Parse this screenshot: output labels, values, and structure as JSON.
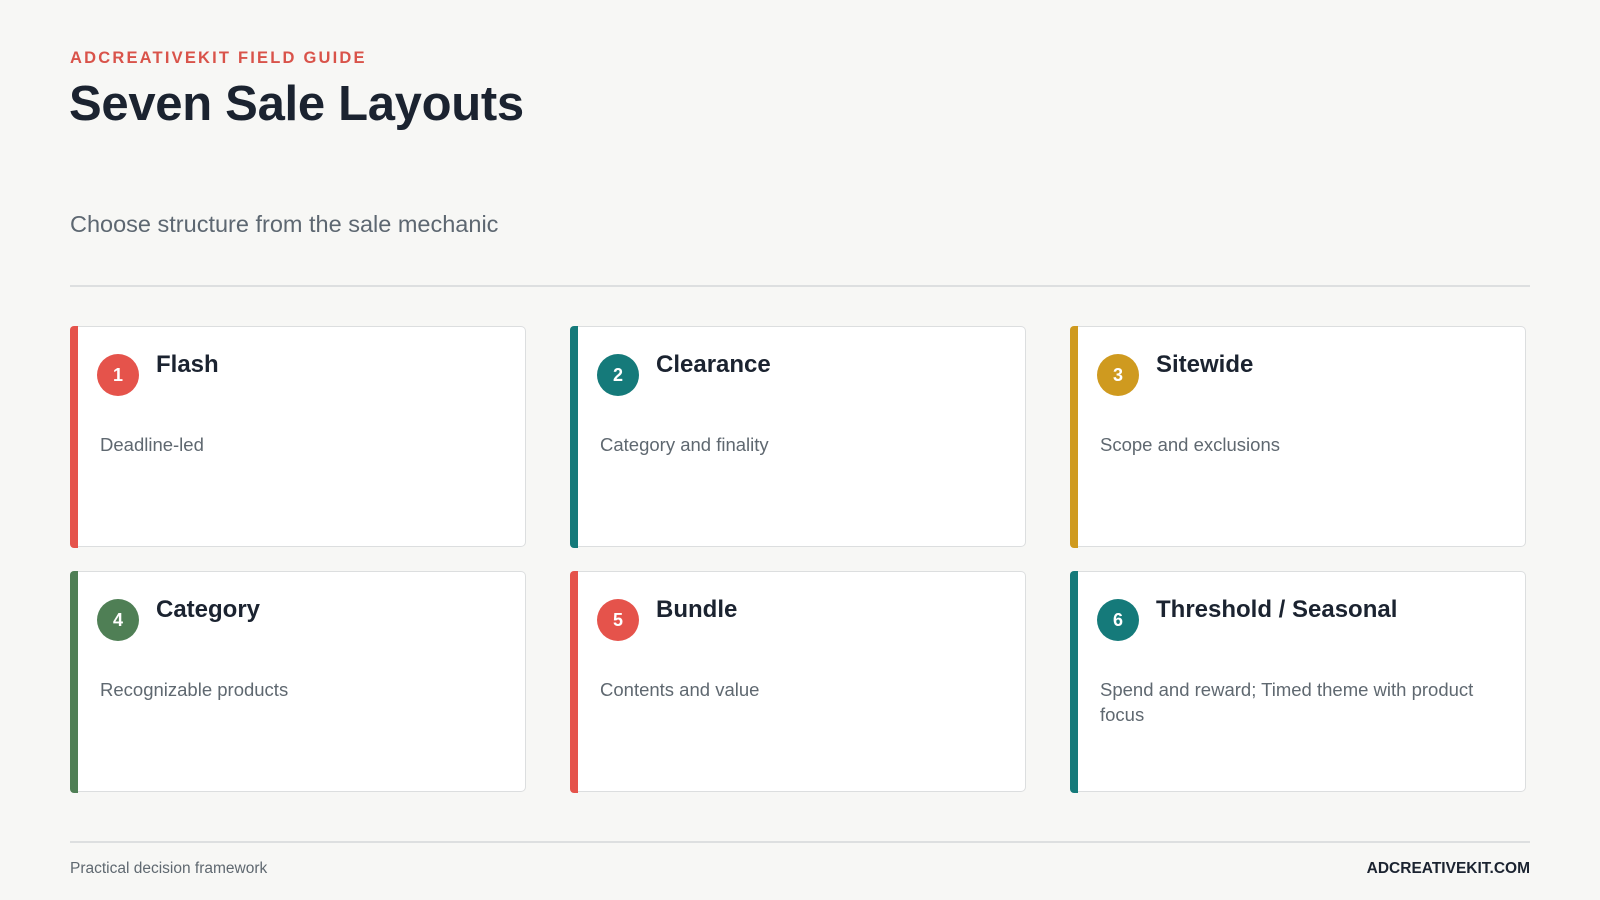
{
  "header": {
    "eyebrow": "ADCREATIVEKIT FIELD GUIDE",
    "title": "Seven Sale Layouts",
    "subtitle": "Choose structure from the sale mechanic"
  },
  "cards": [
    {
      "number": "1",
      "name": "Flash",
      "description": "Deadline-led",
      "color": "#e5534b"
    },
    {
      "number": "2",
      "name": "Clearance",
      "description": "Category and finality",
      "color": "#157a7a"
    },
    {
      "number": "3",
      "name": "Sitewide",
      "description": "Scope and exclusions",
      "color": "#cf9a1f"
    },
    {
      "number": "4",
      "name": "Category",
      "description": "Recognizable products",
      "color": "#4f7f55"
    },
    {
      "number": "5",
      "name": "Bundle",
      "description": "Contents and value",
      "color": "#e5534b"
    },
    {
      "number": "6",
      "name": "Threshold / Seasonal",
      "description": "Spend and reward; Timed theme with product focus",
      "color": "#157a7a"
    }
  ],
  "footer": {
    "left": "Practical decision framework",
    "right": "ADCREATIVEKIT.COM"
  }
}
